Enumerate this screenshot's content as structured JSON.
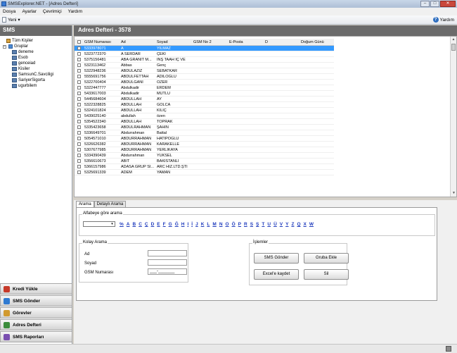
{
  "window": {
    "title": "SMSExplorer.NET - [Adres Defteri]"
  },
  "menu": [
    "Dosya",
    "Ayarlar",
    "Çevrimiçi",
    "Yardım"
  ],
  "toolbar": {
    "new_label": "Yeni",
    "help_label": "Yardım"
  },
  "left": {
    "title": "SMS",
    "tree": {
      "all": "Tüm Kişiler",
      "groups": "Gruplar",
      "children": [
        "deneme",
        "Esob",
        "genceiad",
        "Kisiler",
        "SamsunC.Savciligi",
        "SariyerSigorta",
        "ugurbilem"
      ]
    },
    "buttons": [
      {
        "label": "Kredi Yükle",
        "color": "#c73a2a"
      },
      {
        "label": "SMS Gönder",
        "color": "#2f7ad1"
      },
      {
        "label": "Görevler",
        "color": "#d19a2f"
      },
      {
        "label": "Adres Defteri",
        "color": "#3b8c3b"
      },
      {
        "label": "SMS Raporları",
        "color": "#7a4fb0"
      }
    ]
  },
  "main": {
    "title": "Adres Defteri   - 3578"
  },
  "grid": {
    "columns": [
      "GSM Numarası",
      "Ad",
      "Soyad",
      "GSM No 2",
      "E-Posta",
      "D",
      "Doğum Günü"
    ],
    "rows": [
      [
        "5333978071",
        "A",
        "YILMAZ"
      ],
      [
        "5323772370",
        "A SERDAR",
        "ÇEKİ"
      ],
      [
        "5375156481",
        "ABA GRANIT M...",
        "INŞ TAAH İÇ VE"
      ],
      [
        "5323113462",
        "Abbas",
        "Genç"
      ],
      [
        "5322948236",
        "ABDULAZIZ",
        "SEBATKAR"
      ],
      [
        "5555691756",
        "ABDÜLFETTAH",
        "ADILOĞLU"
      ],
      [
        "5322700404",
        "ABDULGANI",
        "ÖZER"
      ],
      [
        "5322447777",
        "Abdulkadir",
        "ERDEM"
      ],
      [
        "5433617003",
        "Abdulkadir",
        "MUTLU"
      ],
      [
        "5445684604",
        "ABDULLAH",
        "AY"
      ],
      [
        "5322328825",
        "ABDULLAH",
        "GOLCA"
      ],
      [
        "5324101824",
        "ABDULLAH",
        "KILIÇ"
      ],
      [
        "5439025140",
        "abdullah",
        "özen"
      ],
      [
        "5354522340",
        "ABDULLAH",
        "TOPRAK"
      ],
      [
        "5335423658",
        "ABDULRAHMAN",
        "ŞAHIN"
      ],
      [
        "5336649701",
        "Abdurrahman",
        "Battal"
      ],
      [
        "5054571010",
        "ABDURRAHMAN",
        "HATIPOĞLU"
      ],
      [
        "5326626382",
        "ABDURRAHMAN",
        "KARAKELLE"
      ],
      [
        "5307677985",
        "ABDURRAHMAN",
        "YERLİKAYA"
      ],
      [
        "5334390439",
        "Abdurrahman",
        "YÜKSEL"
      ],
      [
        "5356610673",
        "ABIT",
        "BAKISTANLI"
      ],
      [
        "5366157986",
        "ADASA GRUP SI...",
        "ARC HIZ.LTD.ŞTI"
      ],
      [
        "5325691339",
        "ADEM",
        "YAMAN"
      ]
    ]
  },
  "tabs": [
    "Arama",
    "Detaylı Arama"
  ],
  "alphabet": {
    "legend": "Alfabeye göre arama",
    "letters": [
      "%",
      "A",
      "B",
      "C",
      "Ç",
      "D",
      "E",
      "F",
      "G",
      "Ğ",
      "H",
      "I",
      "İ",
      "J",
      "K",
      "L",
      "M",
      "N",
      "O",
      "Ö",
      "P",
      "R",
      "S",
      "Ş",
      "T",
      "U",
      "Ü",
      "V",
      "Y",
      "Z",
      "Q",
      "X",
      "W"
    ]
  },
  "kolay": {
    "legend": "Kolay Arama",
    "ad_label": "Ad",
    "soyad_label": "Soyad",
    "gsm_label": "GSM Numarası",
    "gsm_mask": "___-_______"
  },
  "islemler": {
    "legend": "İşlemler",
    "sms_gonder": "SMS Gönder",
    "gruba_ekle": "Gruba Ekle",
    "excel": "Excel'e kaydet",
    "sil": "Sil"
  }
}
